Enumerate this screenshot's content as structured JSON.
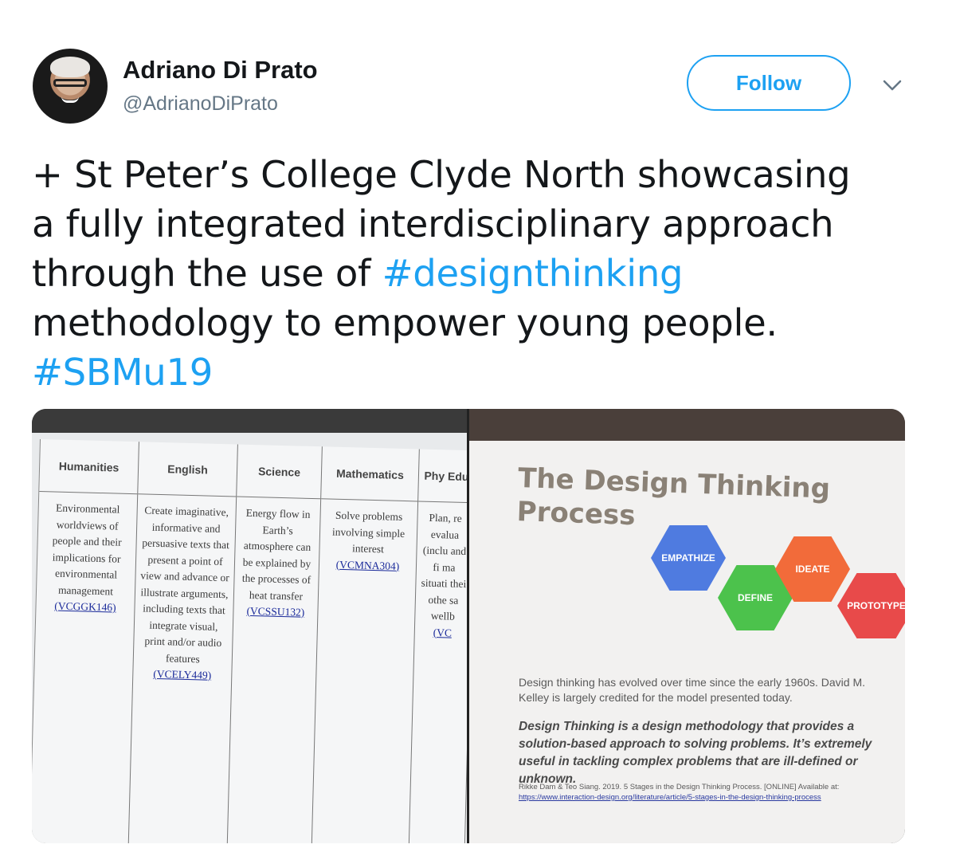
{
  "user": {
    "name": "Adriano Di Prato",
    "handle": "@AdrianoDiPrato"
  },
  "actions": {
    "follow_label": "Follow",
    "menu_icon": "chevron-down-icon"
  },
  "tweet": {
    "lines": [
      "+ St Peter’s College Clyde North showcasing",
      "a fully integrated interdisciplinary approach",
      "through the use of ",
      "methodology to empower young people."
    ],
    "hashtag1": "#designthinking",
    "hashtag2": "#SBMu19"
  },
  "photo_left": {
    "columns": [
      {
        "header": "Humanities",
        "body": "Environmental worldviews of people and their implications for environmental management",
        "code": "(VCGGK146)"
      },
      {
        "header": "English",
        "body": "Create imaginative, informative and persuasive texts that present a point of view and advance or illustrate arguments, including texts that integrate visual, print and/or audio features",
        "code": "(VCELY449)"
      },
      {
        "header": "Science",
        "body": "Energy flow in Earth’s atmosphere can be explained by the processes of heat transfer",
        "code": "(VCSSU132)"
      },
      {
        "header": "Mathematics",
        "body": "Solve problems involving simple interest",
        "code": "(VCMNA304)"
      },
      {
        "header": "Phy Edu",
        "body": "Plan, re evalua (inclu and fi ma situati thei othe sa wellb",
        "code": "(VC"
      }
    ]
  },
  "photo_right": {
    "title_line1": "The Design Thinking",
    "title_line2": "Process",
    "stages": [
      "EMPATHIZE",
      "DEFINE",
      "IDEATE",
      "PROTOTYPE"
    ],
    "stage_colors": [
      "#4f7be0",
      "#4cc24c",
      "#f26b3a",
      "#e84a4a"
    ],
    "para1": "Design thinking has evolved over time since the early 1960s. David M. Kelley is largely credited for the model presented today.",
    "para2": "Design Thinking is a design methodology that provides a solution-based approach to solving problems. It’s extremely useful in tackling complex problems that are ill-defined or unknown.",
    "citation": "Rikke Dam & Teo Siang. 2019. 5 Stages in the Design Thinking Process. [ONLINE] Available at:",
    "citation_link": "https://www.interaction-design.org/literature/article/5-stages-in-the-design-thinking-process"
  }
}
